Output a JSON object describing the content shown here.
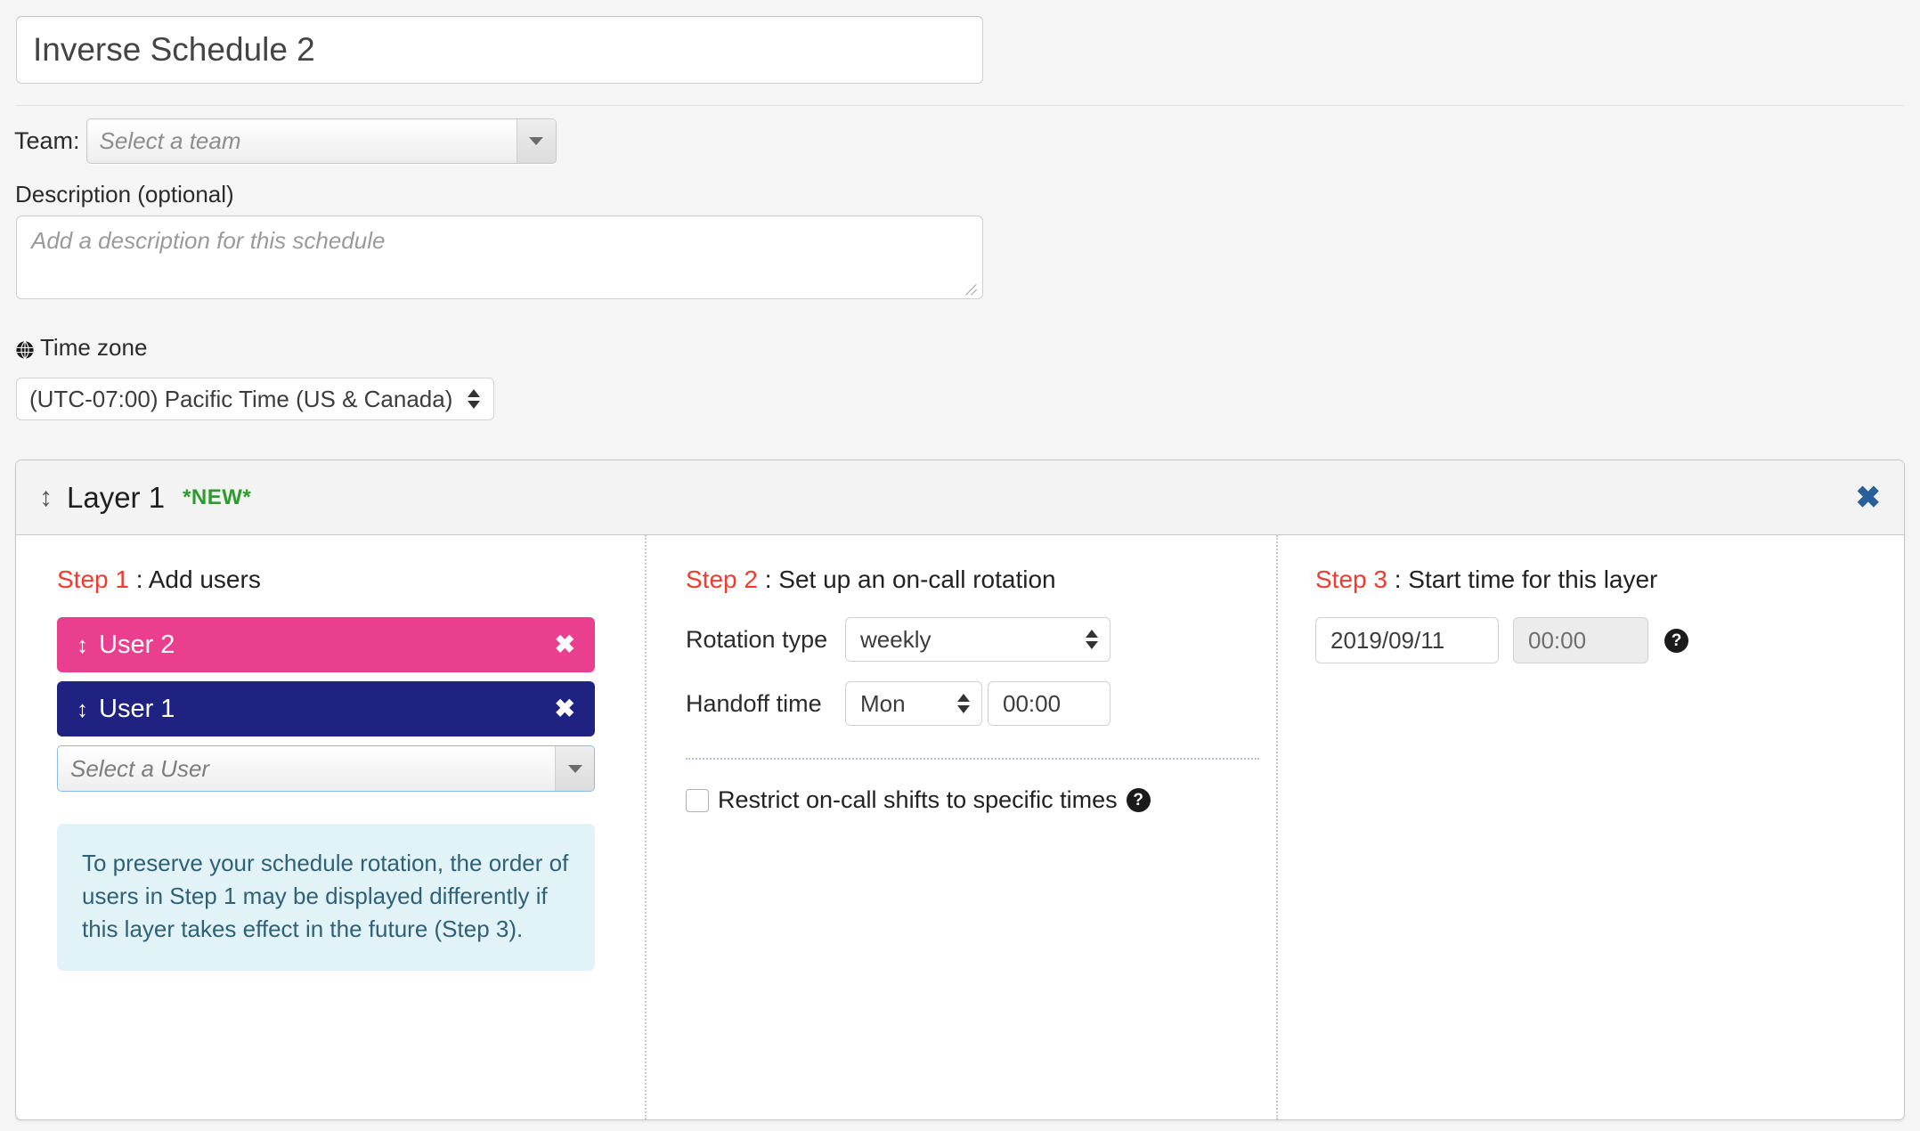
{
  "schedule": {
    "name_value": "Inverse Schedule 2",
    "team_label": "Team:",
    "team_placeholder": "Select a team",
    "description_label": "Description (optional)",
    "description_placeholder": "Add a description for this schedule",
    "timezone_label": "Time zone",
    "timezone_value": "(UTC-07:00) Pacific Time (US & Canada)",
    "globe_icon": "globe-icon"
  },
  "layer": {
    "title": "Layer 1",
    "badge": "*NEW*",
    "badge_color": "#2e9b2e",
    "drag_handle_icon": "drag-vertical-icon",
    "close_icon": "close-icon",
    "close_glyph": "✖",
    "close_color": "#2a6099"
  },
  "step1": {
    "num": "Step 1",
    "sep": " : ",
    "title": "Add users",
    "users": [
      {
        "name": "User 2",
        "color": "#ea3f8e",
        "handle_icon": "drag-vertical-icon",
        "remove_icon": "remove-user-icon",
        "remove_glyph": "✖"
      },
      {
        "name": "User 1",
        "color": "#1f2280",
        "handle_icon": "drag-vertical-icon",
        "remove_icon": "remove-user-icon",
        "remove_glyph": "✖"
      }
    ],
    "user_select_placeholder": "Select a User",
    "info_text": "To preserve your schedule rotation, the order of users in Step 1 may be displayed differently if this layer takes effect in the future (Step 3).",
    "info_bg": "#e2f3f8",
    "info_color": "#2f6176"
  },
  "step2": {
    "num": "Step 2",
    "sep": " : ",
    "title": "Set up an on-call rotation",
    "rotation_type_label": "Rotation type",
    "rotation_type_value": "weekly",
    "handoff_time_label": "Handoff time",
    "handoff_day_value": "Mon",
    "handoff_time_value": "00:00",
    "restrict_label": "Restrict on-call shifts to specific times",
    "restrict_checked": false,
    "restrict_help_icon": "help-icon",
    "restrict_help_glyph": "?"
  },
  "step3": {
    "num": "Step 3",
    "sep": " : ",
    "title": "Start time for this layer",
    "date_value": "2019/09/11",
    "time_value": "00:00",
    "help_icon": "help-icon",
    "help_glyph": "?"
  },
  "accent": {
    "step_red": "#f03c2e",
    "focus_blue": "#89bce8"
  }
}
